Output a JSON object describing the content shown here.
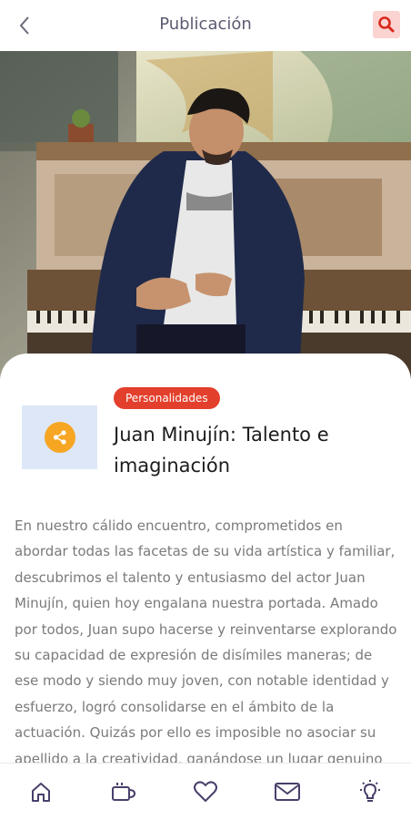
{
  "header": {
    "title": "Publicación"
  },
  "article": {
    "category": "Personalidades",
    "title": "Juan Minujín: Talento e imaginación",
    "body": "En nuestro cálido encuentro, comprometidos en abordar todas las facetas de su vida artística y familiar, descubrimos el talento y entusiasmo del actor Juan Minujín, quien hoy engalana nuestra portada. Amado por todos, Juan supo hacerse y reinventarse explorando su capacidad de expresión de disímiles maneras; de ese modo y siendo muy joven, con notable identidad y esfuerzo, logró consolidarse en el ámbito de la actuación. Quizás por ello es imposible no asociar su apellido a la creatividad, ganándose un lugar genuino en"
  },
  "colors": {
    "accent_red": "#e2402c",
    "search_bg": "#fbd3d1",
    "share_orange": "#f6a623",
    "nav_icon": "#4a3f6b"
  },
  "nav": [
    {
      "icon": "home-icon"
    },
    {
      "icon": "coffee-cup-icon"
    },
    {
      "icon": "heart-icon"
    },
    {
      "icon": "mail-icon"
    },
    {
      "icon": "lightbulb-icon"
    }
  ]
}
